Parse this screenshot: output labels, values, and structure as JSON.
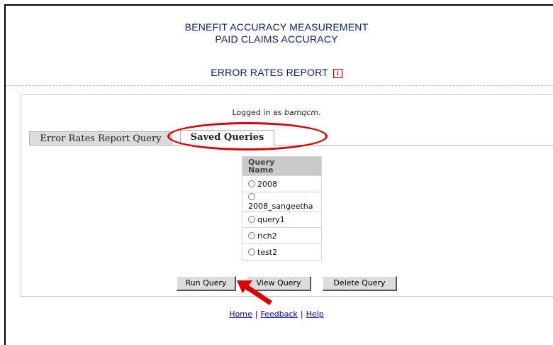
{
  "header": {
    "line1": "BENEFIT ACCURACY MEASUREMENT",
    "line2": "PAID CLAIMS ACCURACY",
    "report_title": "ERROR RATES REPORT",
    "info_icon": "i"
  },
  "session": {
    "prefix": "Logged in as ",
    "username": "bamqcm",
    "suffix": "."
  },
  "tabs": [
    {
      "label": "Error Rates Report Query",
      "active": false
    },
    {
      "label": "Saved Queries",
      "active": true
    }
  ],
  "queries": {
    "header": [
      "Query",
      "Name"
    ],
    "items": [
      "2008",
      "2008_sangeetha",
      "query1",
      "rich2",
      "test2"
    ]
  },
  "buttons": {
    "run": "Run Query",
    "view": "View Query",
    "delete": "Delete Query"
  },
  "footer": {
    "home": "Home",
    "feedback": "Feedback",
    "help": "Help",
    "separator": "|"
  },
  "colors": {
    "header_text": "#0b1f6b",
    "annotation": "#d90000",
    "link": "#0000cc"
  }
}
